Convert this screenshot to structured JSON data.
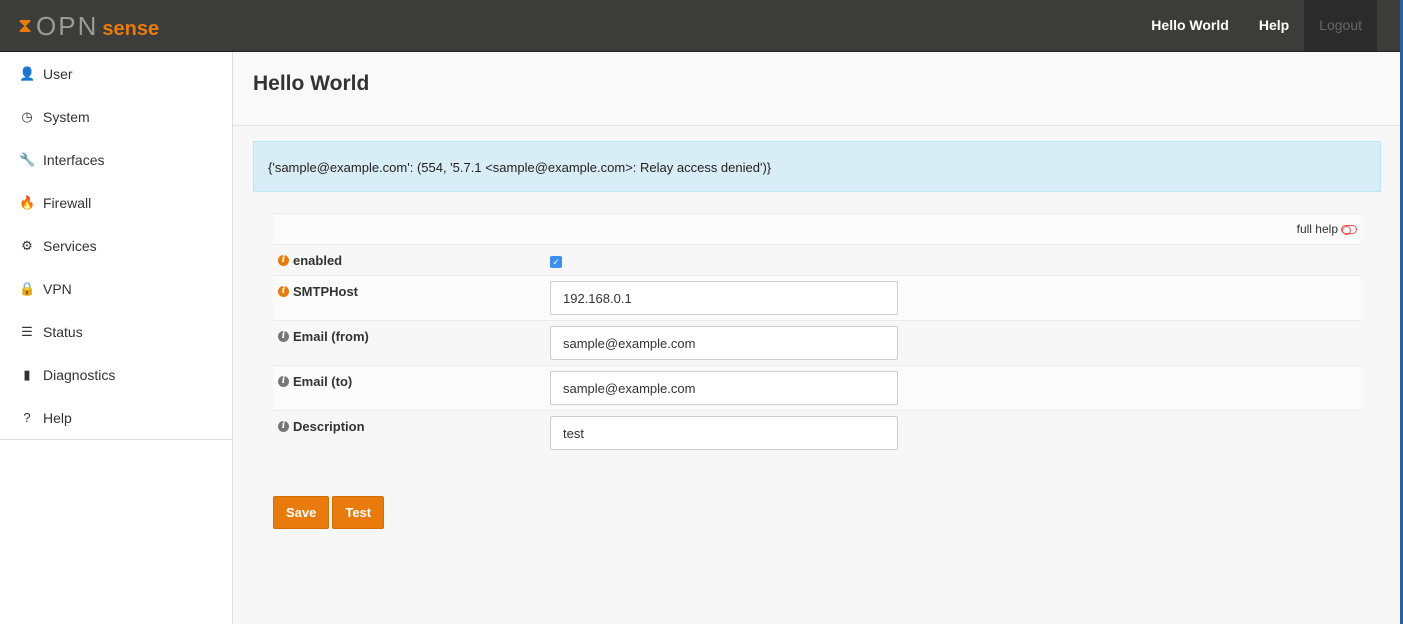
{
  "header": {
    "logo_text_main": "OPN",
    "logo_text_accent": "sense",
    "nav": [
      "Hello World",
      "Help",
      "Logout"
    ]
  },
  "sidebar": {
    "items": [
      {
        "label": "User",
        "icon": "user-icon",
        "glyph": "👤"
      },
      {
        "label": "System",
        "icon": "dashboard-icon",
        "glyph": "◷"
      },
      {
        "label": "Interfaces",
        "icon": "wrench-icon",
        "glyph": "🔧"
      },
      {
        "label": "Firewall",
        "icon": "fire-icon",
        "glyph": "🔥"
      },
      {
        "label": "Services",
        "icon": "cog-icon",
        "glyph": "⚙"
      },
      {
        "label": "VPN",
        "icon": "lock-icon",
        "glyph": "🔒"
      },
      {
        "label": "Status",
        "icon": "server-icon",
        "glyph": "☰"
      },
      {
        "label": "Diagnostics",
        "icon": "bar-chart-icon",
        "glyph": "▮"
      },
      {
        "label": "Help",
        "icon": "question-icon",
        "glyph": "?"
      }
    ]
  },
  "page": {
    "title": "Hello World",
    "alert": "{'sample@example.com': (554, '5.7.1 <sample@example.com>: Relay access denied')}",
    "full_help": "full help",
    "fields": {
      "enabled": {
        "label": "enabled",
        "checked": true
      },
      "smtphost": {
        "label": "SMTPHost",
        "value": "192.168.0.1"
      },
      "from": {
        "label": "Email (from)",
        "value": "sample@example.com"
      },
      "to": {
        "label": "Email (to)",
        "value": "sample@example.com"
      },
      "description": {
        "label": "Description",
        "value": "test"
      }
    },
    "save": "Save",
    "test": "Test"
  },
  "colors": {
    "accent": "#e87b0b",
    "header": "#3c3c3b",
    "alert_bg": "#d9edf7"
  }
}
